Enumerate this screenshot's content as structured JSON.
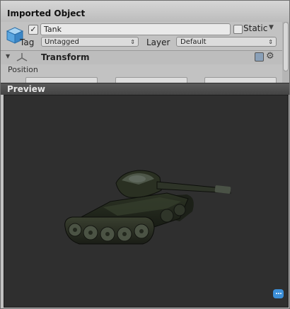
{
  "window": {
    "title": "Imported Object"
  },
  "object": {
    "active": true,
    "name": "Tank",
    "static_label": "Static",
    "static_checked": false,
    "tag_label": "Tag",
    "tag_value": "Untagged",
    "layer_label": "Layer",
    "layer_value": "Default"
  },
  "transform": {
    "title": "Transform",
    "position_label": "Position",
    "icons": {
      "help": "help-book-icon",
      "settings": "gear-icon"
    }
  },
  "preview": {
    "title": "Preview",
    "background": "#2f2f2f",
    "subject": "tank-3d-model"
  },
  "colors": {
    "panel": "#c2c2c2",
    "preview_header": "#4f4f4f",
    "accent": "#3c8fd8"
  }
}
